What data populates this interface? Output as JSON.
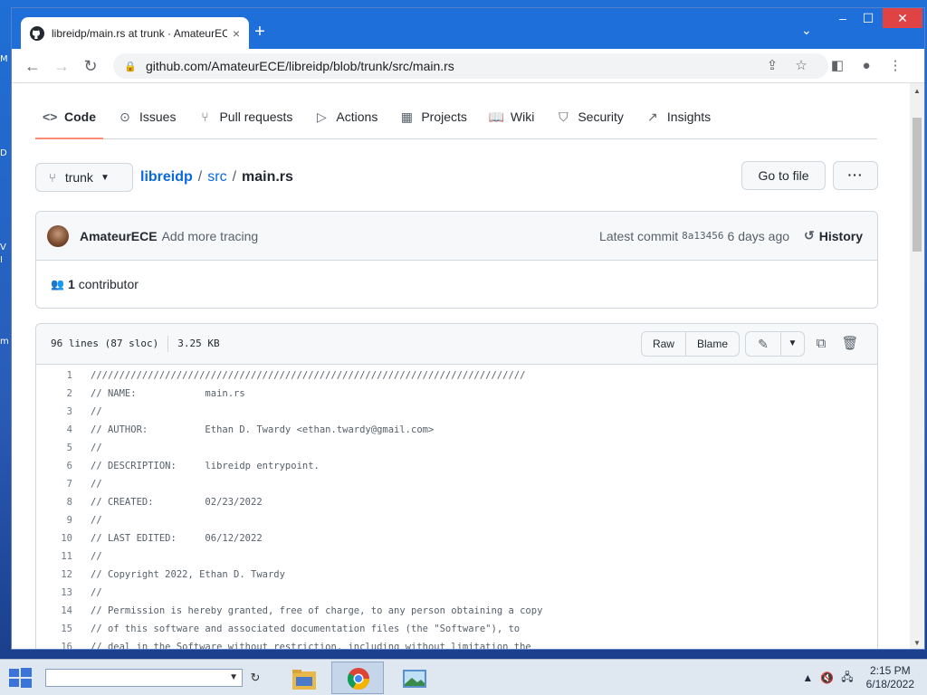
{
  "desktop": {
    "edge_fragments": [
      "M",
      "D",
      "V",
      "I",
      "m"
    ]
  },
  "browser": {
    "tab_title": "libreidp/main.rs at trunk · AmateurECE",
    "tab_close": "×",
    "new_tab": "+",
    "tab_search": "⌄",
    "url": "github.com/AmateurECE/libreidp/blob/trunk/src/main.rs",
    "window_controls": {
      "minimize": "–",
      "maximize": "☐",
      "close": "✕"
    }
  },
  "repo_nav": {
    "tabs": [
      {
        "label": "Code",
        "icon": "<>",
        "active": true
      },
      {
        "label": "Issues",
        "icon": "⊙"
      },
      {
        "label": "Pull requests",
        "icon": "⑂"
      },
      {
        "label": "Actions",
        "icon": "▷"
      },
      {
        "label": "Projects",
        "icon": "▦"
      },
      {
        "label": "Wiki",
        "icon": "📖"
      },
      {
        "label": "Security",
        "icon": "⛉"
      },
      {
        "label": "Insights",
        "icon": "↗"
      }
    ]
  },
  "file_nav": {
    "branch": "trunk",
    "repo": "libreidp",
    "dir": "src",
    "file": "main.rs",
    "separator": "/",
    "go_to_file": "Go to file",
    "more": "···"
  },
  "commit": {
    "author": "AmateurECE",
    "message": "Add more tracing",
    "latest_label": "Latest commit",
    "sha": "8a13456",
    "age": "6 days ago",
    "history_label": "History",
    "contributors_count": "1",
    "contributors_label": "contributor"
  },
  "file": {
    "lines_info": "96 lines (87 sloc)",
    "size": "3.25 KB",
    "raw_label": "Raw",
    "blame_label": "Blame"
  },
  "code_lines": [
    {
      "n": "1",
      "text": "////////////////////////////////////////////////////////////////////////////"
    },
    {
      "n": "2",
      "text": "// NAME:            main.rs"
    },
    {
      "n": "3",
      "text": "//"
    },
    {
      "n": "4",
      "text": "// AUTHOR:          Ethan D. Twardy <ethan.twardy@gmail.com>"
    },
    {
      "n": "5",
      "text": "//"
    },
    {
      "n": "6",
      "text": "// DESCRIPTION:     libreidp entrypoint."
    },
    {
      "n": "7",
      "text": "//"
    },
    {
      "n": "8",
      "text": "// CREATED:         02/23/2022"
    },
    {
      "n": "9",
      "text": "//"
    },
    {
      "n": "10",
      "text": "// LAST EDITED:     06/12/2022"
    },
    {
      "n": "11",
      "text": "//"
    },
    {
      "n": "12",
      "text": "// Copyright 2022, Ethan D. Twardy"
    },
    {
      "n": "13",
      "text": "//"
    },
    {
      "n": "14",
      "text": "// Permission is hereby granted, free of charge, to any person obtaining a copy"
    },
    {
      "n": "15",
      "text": "// of this software and associated documentation files (the \"Software\"), to"
    },
    {
      "n": "16",
      "text": "// deal in the Software without restriction, including without limitation the"
    }
  ],
  "taskbar": {
    "clock_time": "2:15 PM",
    "clock_date": "6/18/2022"
  },
  "colors": {
    "accent_tab_underline": "#fd8c73",
    "link": "#0969da",
    "titlebar": "#1e6fd9"
  }
}
